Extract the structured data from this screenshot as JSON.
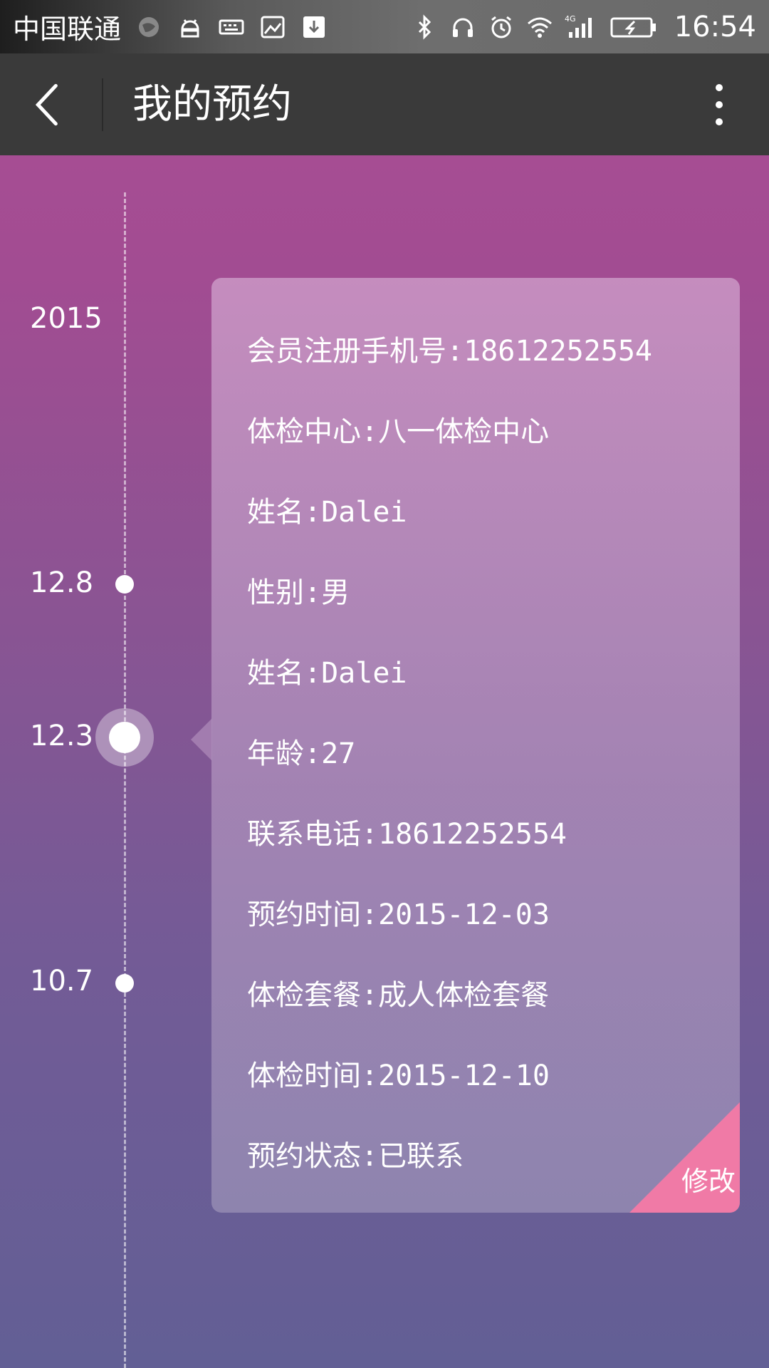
{
  "status_bar": {
    "carrier": "中国联通",
    "network": "4G",
    "time": "16:54",
    "icons": [
      "globe-icon",
      "android-icon",
      "keyboard-icon",
      "image-icon",
      "download-icon",
      "bluetooth-icon",
      "headphones-icon",
      "alarm-icon",
      "wifi-icon",
      "signal-icon",
      "battery-charging-icon"
    ]
  },
  "app_bar": {
    "title": "我的预约",
    "back_icon": "back-arrow-icon",
    "more_icon": "more-vert-icon"
  },
  "timeline": {
    "year": "2015",
    "entries": [
      {
        "label": "12.8",
        "selected": false
      },
      {
        "label": "12.3",
        "selected": true
      },
      {
        "label": "10.7",
        "selected": false
      }
    ]
  },
  "appointment": {
    "rows": [
      "会员注册手机号:18612252554",
      "体检中心:八一体检中心",
      "姓名:Dalei",
      "性别:男",
      "姓名:Dalei",
      "年龄:27",
      "联系电话:18612252554",
      "预约时间:2015-12-03",
      "体检套餐:成人体检套餐",
      "体检时间:2015-12-10",
      "预约状态:已联系"
    ],
    "edit_label": "修改",
    "edit_color": "#f07aa6"
  }
}
